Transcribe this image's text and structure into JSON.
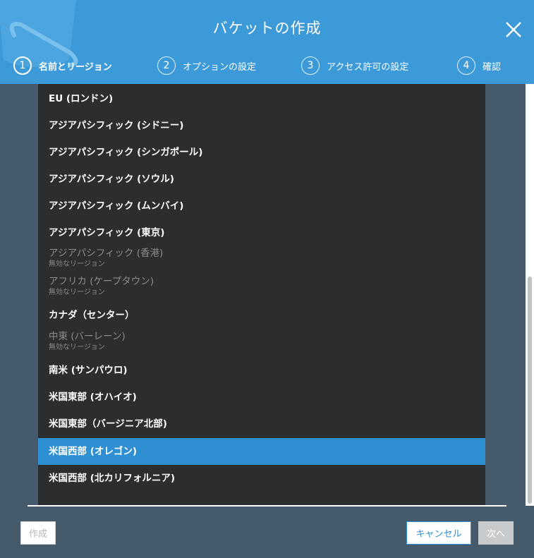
{
  "dialog": {
    "title": "バケットの作成"
  },
  "steps": [
    {
      "number": "1",
      "label": "名前とリージョン",
      "active": true
    },
    {
      "number": "2",
      "label": "オプションの設定",
      "active": false
    },
    {
      "number": "3",
      "label": "アクセス許可の設定",
      "active": false
    },
    {
      "number": "4",
      "label": "確認",
      "active": false
    }
  ],
  "regions": [
    {
      "label": "EU (ロンドン)",
      "state": "enabled"
    },
    {
      "label": "アジアパシフィック (シドニー)",
      "state": "enabled"
    },
    {
      "label": "アジアパシフィック (シンガポール)",
      "state": "enabled"
    },
    {
      "label": "アジアパシフィック (ソウル)",
      "state": "enabled"
    },
    {
      "label": "アジアパシフィック (ムンバイ)",
      "state": "enabled"
    },
    {
      "label": "アジアパシフィック (東京)",
      "state": "enabled"
    },
    {
      "label": "アジアパシフィック (香港)",
      "state": "disabled",
      "note": "無効なリージョン"
    },
    {
      "label": "アフリカ (ケープタウン)",
      "state": "disabled",
      "note": "無効なリージョン"
    },
    {
      "label": "カナダ（センター）",
      "state": "enabled"
    },
    {
      "label": "中東 (バーレーン)",
      "state": "disabled",
      "note": "無効なリージョン"
    },
    {
      "label": "南米 (サンパウロ)",
      "state": "enabled"
    },
    {
      "label": "米国東部 (オハイオ)",
      "state": "enabled"
    },
    {
      "label": "米国東部（バージニア北部)",
      "state": "enabled"
    },
    {
      "label": "米国西部 (オレゴン)",
      "state": "selected"
    },
    {
      "label": "米国西部 (北カリフォルニア)",
      "state": "enabled"
    }
  ],
  "footer": {
    "create_label": "作成",
    "cancel_label": "キャンセル",
    "next_label": "次へ"
  },
  "colors": {
    "header": "#3d9ad9",
    "selected": "#2f8fd3",
    "list_background": "#2b2d2e",
    "backdrop": "#455a6a"
  },
  "icons": {
    "close": "close-icon",
    "header_decoration": "bucket-decoration-icon"
  }
}
